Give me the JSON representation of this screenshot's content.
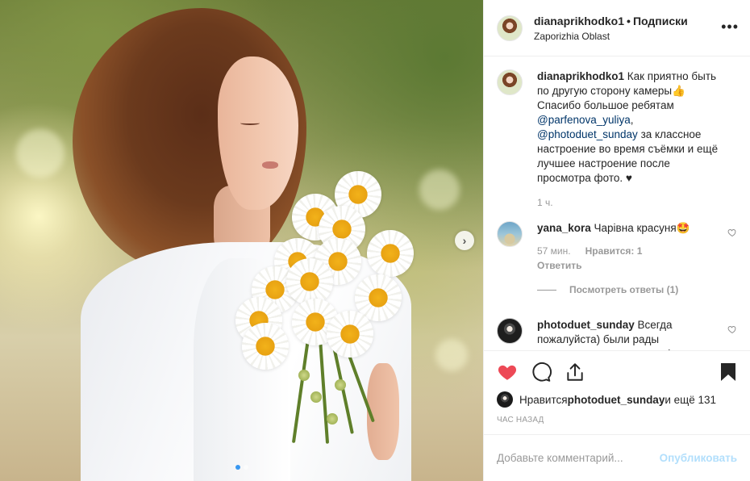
{
  "post": {
    "username": "dianaprikhodko1",
    "follow_label": "Подписки",
    "separator": "•",
    "location": "Zaporizhia Oblast",
    "more_glyph": "•••"
  },
  "caption": {
    "username": "dianaprikhodko1",
    "text_1": " Как приятно быть по другую сторону камеры",
    "emoji": "👍",
    "text_2": " Спасибо большое ребятам ",
    "mention_1": "@parfenova_yuliya",
    "comma": ",",
    "mention_2": "@photoduet_sunday",
    "text_3": " за классное настроение во время съёмки и ещё лучшее настроение после просмотра фото. ♥",
    "time": "1 ч."
  },
  "comments": [
    {
      "username": "yana_kora",
      "text": " Чарівна красуня🤩",
      "time": "57 мин.",
      "likes": "Нравится: 1",
      "reply": "Ответить",
      "view_replies": "Посмотреть ответы (1)"
    },
    {
      "username": "photoduet_sunday",
      "text": " Всегда пожалуйста) были рады создавать красоту вместе)"
    }
  ],
  "actions": {
    "liked_by_prefix": "Нравится ",
    "liked_by_user": "photoduet_sunday",
    "liked_by_suffix": " и ещё 131",
    "time_ago": "ЧАС НАЗАД"
  },
  "composer": {
    "placeholder": "Добавьте комментарий...",
    "publish_label": "Опубликовать"
  },
  "carousel": {
    "next_glyph": "›",
    "current_slide": 1,
    "total_slides": 2
  },
  "colors": {
    "like_red": "#ed4956",
    "link_blue": "#003569",
    "publish_disabled": "#b2dffc",
    "carousel_active": "#3897f0"
  },
  "icons": [
    "heart-filled-icon",
    "comment-icon",
    "share-icon",
    "bookmark-filled-icon",
    "heart-outline-icon",
    "chevron-right-icon"
  ]
}
